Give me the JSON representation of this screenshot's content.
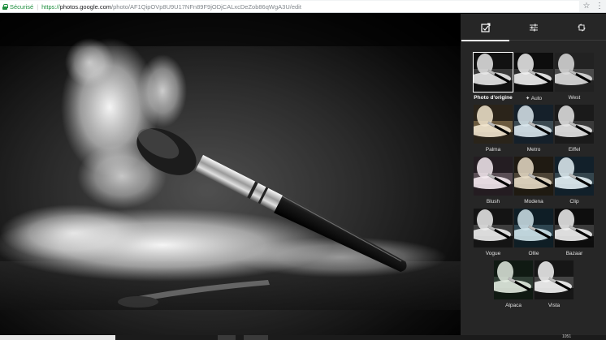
{
  "browser": {
    "secure_label": "Sécurisé",
    "separator": "|",
    "url_scheme": "https://",
    "url_host": "photos.google.com",
    "url_path": "/photo/AF1QipOVp8U9U17NFn89F9jODjCALxcDeZob86qWgA3U/edit",
    "star_icon": "☆",
    "menu_icon": "⋮"
  },
  "panel": {
    "tabs": [
      {
        "name": "save-to-library",
        "active": true
      },
      {
        "name": "adjustments",
        "active": false
      },
      {
        "name": "crop-rotate",
        "active": false
      }
    ],
    "filters": [
      {
        "label": "Photo d'origine",
        "selected": true,
        "tone": "orig"
      },
      {
        "label": "Auto",
        "selected": false,
        "tone": "auto"
      },
      {
        "label": "West",
        "selected": false,
        "tone": "west"
      },
      {
        "label": "Palma",
        "selected": false,
        "tone": "palma"
      },
      {
        "label": "Metro",
        "selected": false,
        "tone": "metro"
      },
      {
        "label": "Eiffel",
        "selected": false,
        "tone": "eiffel"
      },
      {
        "label": "Blush",
        "selected": false,
        "tone": "blush"
      },
      {
        "label": "Modena",
        "selected": false,
        "tone": "modena"
      },
      {
        "label": "Clip",
        "selected": false,
        "tone": "clip"
      },
      {
        "label": "Vogue",
        "selected": false,
        "tone": "vogue"
      },
      {
        "label": "Ollie",
        "selected": false,
        "tone": "ollie"
      },
      {
        "label": "Bazaar",
        "selected": false,
        "tone": "bazaar"
      },
      {
        "label": "Alpaca",
        "selected": false,
        "tone": "alpaca"
      },
      {
        "label": "Vista",
        "selected": false,
        "tone": "vista"
      }
    ]
  },
  "taskbar": {
    "time_text": "1051"
  },
  "colors": {
    "panel_bg": "#262626",
    "secure_green": "#1e8e3e",
    "annotation_red": "#e0141b"
  }
}
